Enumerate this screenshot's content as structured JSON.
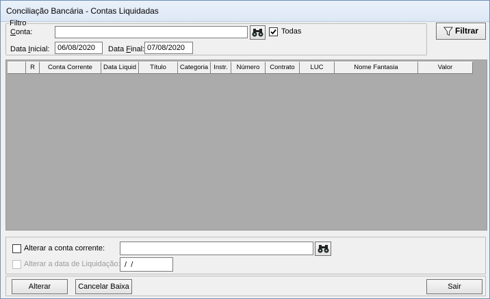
{
  "window": {
    "title": "Conciliação Bancária - Contas Liquidadas"
  },
  "filtro": {
    "legend": "Filtro",
    "conta_label": "Conta:",
    "conta_value": "",
    "todas_label": "Todas",
    "todas_checked": true,
    "data_inicial_label": "Data Inicial:",
    "data_inicial_value": "06/08/2020",
    "data_final_label": "Data Final:",
    "data_final_value": "07/08/2020",
    "filtrar_label": "Filtrar"
  },
  "grid": {
    "columns": [
      "R",
      "Conta Corrente",
      "Data Liquid",
      "Título",
      "Categoria",
      "Instr.",
      "Número",
      "Contrato",
      "LUC",
      "Nome Fantasia",
      "Valor"
    ],
    "rows": []
  },
  "options": {
    "alterar_conta_label": "Alterar a conta corrente:",
    "alterar_conta_checked": false,
    "alterar_conta_value": "",
    "alterar_data_label": "Alterar a data de Liquidação:",
    "alterar_data_checked": false,
    "alterar_data_value": " /  /"
  },
  "buttons": {
    "alterar": "Alterar",
    "cancelar": "Cancelar Baixa",
    "sair": "Sair"
  },
  "icons": {
    "search": "binoculars-icon",
    "filter": "funnel-icon"
  }
}
